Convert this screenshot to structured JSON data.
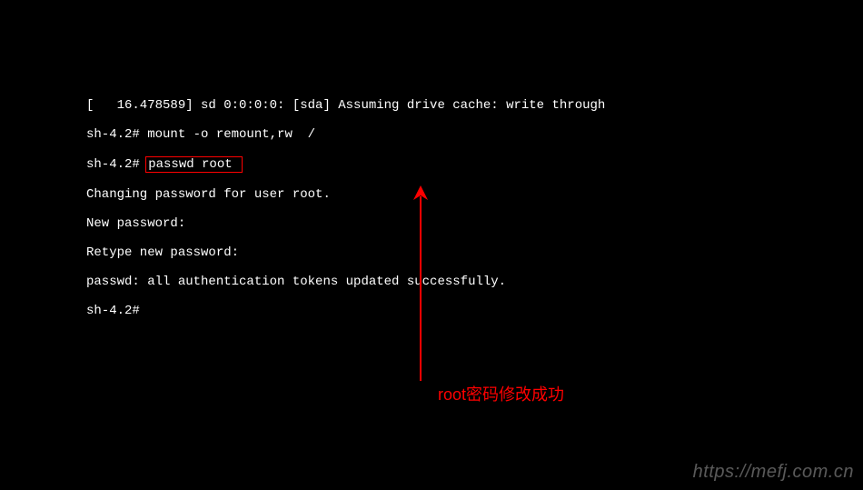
{
  "terminal": {
    "lines": {
      "l1": "[   16.478589] sd 0:0:0:0: [sda] Assuming drive cache: write through",
      "l2_prompt": "sh-4.2# ",
      "l2_cmd": "mount -o remount,rw  /",
      "l3_prompt": "sh-4.2# ",
      "l3_cmd": "passwd root ",
      "l4": "Changing password for user root.",
      "l5": "New password:",
      "l6": "Retype new password:",
      "l7": "passwd: all authentication tokens updated successfully.",
      "l8": "sh-4.2# "
    }
  },
  "annotation": {
    "text": "root密码修改成功"
  },
  "watermark": {
    "text": "https://mefj.com.cn"
  },
  "colors": {
    "highlight": "#ff0000",
    "terminal_bg": "#000000",
    "terminal_fg": "#ffffff"
  }
}
